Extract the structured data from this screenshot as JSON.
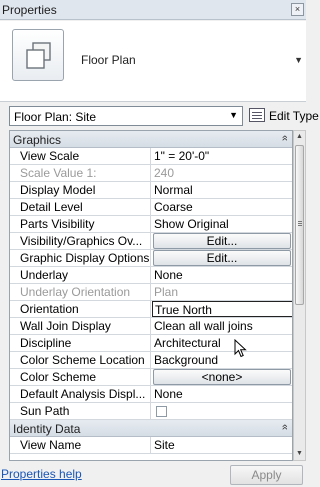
{
  "window": {
    "title": "Properties",
    "close_glyph": "×"
  },
  "type_selector": {
    "name": "Floor Plan",
    "icon": "floor-plan-icon"
  },
  "instance_selector": {
    "value": "Floor Plan: Site",
    "edit_type_label": "Edit Type"
  },
  "groups": [
    {
      "name": "Graphics",
      "rows": [
        {
          "name": "View Scale",
          "value": "1\" = 20'-0\"",
          "kind": "text"
        },
        {
          "name": "Scale Value    1:",
          "value": "240",
          "kind": "dim"
        },
        {
          "name": "Display Model",
          "value": "Normal",
          "kind": "text"
        },
        {
          "name": "Detail Level",
          "value": "Coarse",
          "kind": "text"
        },
        {
          "name": "Parts Visibility",
          "value": "Show Original",
          "kind": "text"
        },
        {
          "name": "Visibility/Graphics Ov...",
          "value": "Edit...",
          "kind": "button"
        },
        {
          "name": "Graphic Display Options",
          "value": "Edit...",
          "kind": "button"
        },
        {
          "name": "Underlay",
          "value": "None",
          "kind": "text"
        },
        {
          "name": "Underlay Orientation",
          "value": "Plan",
          "kind": "dim"
        },
        {
          "name": "Orientation",
          "value": "True North",
          "kind": "active"
        },
        {
          "name": "Wall Join Display",
          "value": "Clean all wall joins",
          "kind": "text"
        },
        {
          "name": "Discipline",
          "value": "Architectural",
          "kind": "text"
        },
        {
          "name": "Color Scheme Location",
          "value": "Background",
          "kind": "text"
        },
        {
          "name": "Color Scheme",
          "value": "<none>",
          "kind": "button"
        },
        {
          "name": "Default Analysis Displ...",
          "value": "None",
          "kind": "text"
        },
        {
          "name": "Sun Path",
          "value": "",
          "kind": "checkbox"
        }
      ]
    },
    {
      "name": "Identity Data",
      "rows": [
        {
          "name": "View Name",
          "value": "Site",
          "kind": "text"
        }
      ]
    }
  ],
  "footer": {
    "help_label": "Properties help",
    "apply_label": "Apply"
  },
  "colors": {
    "link": "#1a56b8",
    "group_header": "#dde4eb",
    "disabled_text": "#9a9a9a"
  }
}
